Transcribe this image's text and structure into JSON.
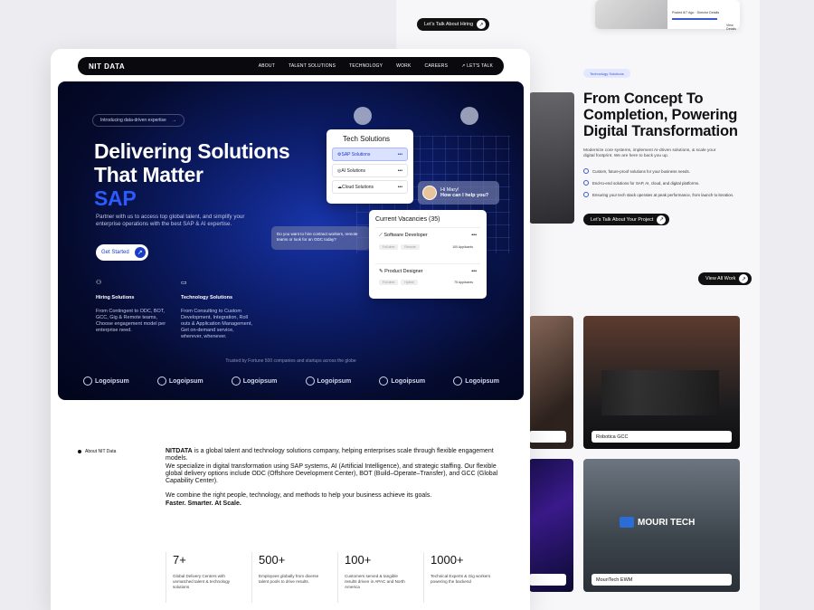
{
  "back": {
    "hire_button": "Let's Talk About Hiring",
    "tag": "Technology Solutions",
    "headline": [
      "From Concept To",
      "Completion, Powering",
      "Digital Transformation"
    ],
    "subtitle": "Modernize core systems, implement AI-driven solutions, & scale your digital footprint. We are here to back you up.",
    "checks": [
      "Custom, future-proof solutions for your business needs.",
      "End-to-end solutions for SAP, AI, cloud, and digital platforms.",
      "Ensuring your tech stack operates at peak performance, from launch to iteration."
    ],
    "project_button": "Let's Talk About Your Project",
    "view_all": "View All Work",
    "cards": [
      {
        "label": ""
      },
      {
        "label": "Robotica GCC"
      },
      {
        "label": ""
      },
      {
        "label": "MouriTech EWM"
      }
    ],
    "mouri_logo": "MOURI TECH",
    "mini_card": {
      "text": "Posted 8/7 Ago · Director Details",
      "link": "View Details"
    }
  },
  "nav": {
    "logo": "NIT DATA",
    "items": [
      "ABOUT",
      "TALENT SOLUTIONS",
      "TECHNOLOGY",
      "WORK",
      "CAREERS"
    ],
    "cta": "LET'S TALK"
  },
  "hero": {
    "pill": "Introducing data-driven expertise",
    "line1": "Delivering Solutions",
    "line2": "That Matter",
    "accent": "SAP",
    "subtitle": "Partner with us to access top global talent, and simplify your enterprise operations with the best SAP & AI expertise.",
    "cta": "Get Started",
    "features": [
      {
        "title": "Hiring Solutions",
        "desc": "From Contingent to ODC, BOT, GCC, Gig & Remote teams, Choose engagement model per enterprise need."
      },
      {
        "title": "Technology Solutions",
        "desc": "From Consulting to Custom Development, Integration, Roll outs & Application Management, Get on-demand service, wherever, whenever."
      }
    ],
    "trusted": "Trusted by Fortune 500 companies and startups across the globe",
    "logos": [
      "Logoipsum",
      "Logoipsum",
      "Logoipsum",
      "Logoipsum",
      "Logoipsum",
      "Logoipsum"
    ]
  },
  "tech_card": {
    "title": "Tech Solutions",
    "rows": [
      "SAP Solutions",
      "AI Solutions",
      "Cloud Solutions"
    ]
  },
  "chat": {
    "text": "Do you want to hire contract workers, remote teams or look for an ODC today?"
  },
  "greeting": {
    "line1": "Hi Mary!",
    "line2": "How can I help you?"
  },
  "vacancies": {
    "title": "Current Vacancies (35)",
    "jobs": [
      {
        "name": "Software Developer",
        "tags": [
          "Full-time",
          "Remote"
        ],
        "applicants": "100 Applicants"
      },
      {
        "name": "Product Designer",
        "tags": [
          "Full-time",
          "Hybrid"
        ],
        "applicants": "75 Applicants"
      }
    ]
  },
  "about": {
    "label": "About NIT Data",
    "brand": "NITDATA",
    "p1": " is a global talent and technology solutions company, helping enterprises scale through flexible engagement models.",
    "p2": "We specialize in digital transformation using SAP systems, AI (Artificial Intelligence), and strategic staffing. Our flexible global delivery options include ODC (Offshore Development Center), BOT (Build–Operate–Transfer), and GCC (Global Capability Center).",
    "p3": "We combine the right people, technology, and methods to help your business achieve its goals.",
    "tagline": "Faster. Smarter. At Scale."
  },
  "stats": [
    {
      "value": "7+",
      "desc": "Global Delivery Centers with unmatched talent & technology solutions"
    },
    {
      "value": "500+",
      "desc": "Employees globally from diverse talent pools to drive results."
    },
    {
      "value": "100+",
      "desc": "Customers served & tangible results driven in APAC and North America"
    },
    {
      "value": "1000+",
      "desc": "Technical Experts & Gig workers powering the backend"
    }
  ]
}
